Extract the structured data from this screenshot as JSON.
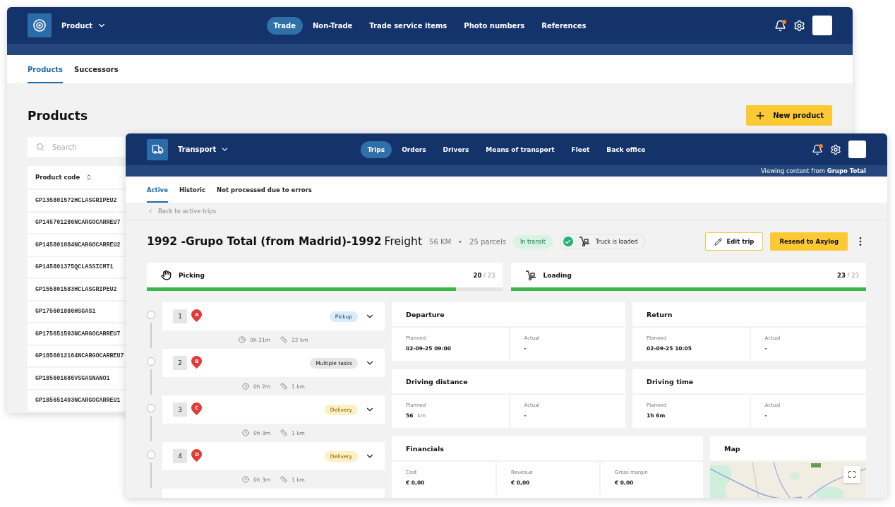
{
  "back_window": {
    "app": "Product",
    "nav": [
      {
        "label": "Trade",
        "selected": true
      },
      {
        "label": "Non-Trade",
        "selected": false
      },
      {
        "label": "Trade service items",
        "selected": false
      },
      {
        "label": "Photo numbers",
        "selected": false
      },
      {
        "label": "References",
        "selected": false
      }
    ],
    "tabs": [
      {
        "label": "Products",
        "selected": true
      },
      {
        "label": "Successors",
        "selected": false
      }
    ],
    "title": "Products",
    "new_button": "New product",
    "search": {
      "placeholder": "Search"
    },
    "table": {
      "columns": [
        "Product code"
      ],
      "rows": [
        "GP135801572HCLASGRIPEU2",
        "GP145701286NCARGOCARREU7",
        "GP145801084NCARGOCARREU2",
        "GP145801375QCLASSICMT1",
        "GP155801583HCLASGRIPEU2",
        "GP175601886HSGAS1",
        "GP175651593NCARGOCARREU7",
        "GP1856012104NCARGOCARREU7",
        "GP185601686VSGASNANO1",
        "GP185651493NCARGOCARREU1"
      ]
    }
  },
  "front_window": {
    "app": "Transport",
    "nav": [
      {
        "label": "Trips",
        "selected": true
      },
      {
        "label": "Orders",
        "selected": false
      },
      {
        "label": "Drivers",
        "selected": false
      },
      {
        "label": "Means of transport",
        "selected": false
      },
      {
        "label": "Fleet",
        "selected": false
      },
      {
        "label": "Back office",
        "selected": false
      }
    ],
    "viewing": "Viewing content from **Grupo Total**",
    "tabs": [
      {
        "label": "Active",
        "selected": true
      },
      {
        "label": "Historic",
        "selected": false
      },
      {
        "label": "Not processed due to errors",
        "selected": false
      }
    ],
    "back_link": "Back to active trips",
    "trip": {
      "title": "1992 -Grupo Total (from Madrid)-1992",
      "type": "Freight",
      "distance": "56 KM",
      "separator": "•",
      "parcels": "25 parcels",
      "status": "In transit",
      "loaded": "Truck is loaded"
    },
    "actions": [
      {
        "label": "Edit trip",
        "kind": "outline"
      },
      {
        "label": "Resend to Axylog",
        "kind": "primary"
      }
    ],
    "progress": [
      {
        "label": "Picking",
        "kind": "picking",
        "done": "20",
        "separator": "/",
        "total": "23",
        "level": 0.87
      },
      {
        "label": "Loading",
        "kind": "loading",
        "done": "23",
        "separator": "/",
        "total": "23",
        "level": 1
      }
    ],
    "stops": [
      {
        "number": "1",
        "marker": "A",
        "tag": "Pickup",
        "kind": "pickup",
        "time": "0h 21m",
        "distance": "22 km"
      },
      {
        "number": "2",
        "marker": "B",
        "tag": "Multiple tasks",
        "kind": "multiple",
        "time": "0h 2m",
        "distance": "1 km"
      },
      {
        "number": "3",
        "marker": "C",
        "tag": "Delivery",
        "kind": "delivery",
        "time": "0h 3m",
        "distance": "1 km"
      },
      {
        "number": "4",
        "marker": "D",
        "tag": "Delivery",
        "kind": "delivery",
        "time": "0h 3m",
        "distance": "1 km"
      }
    ],
    "cards": [
      {
        "title": "Departure",
        "fields": [
          {
            "label": "Planned",
            "value": "02-09-25 09:00"
          },
          {
            "label": "Actual",
            "value": "-"
          }
        ]
      },
      {
        "title": "Return",
        "fields": [
          {
            "label": "Planned",
            "value": "02-09-25 10:05"
          },
          {
            "label": "Actual",
            "value": "-"
          }
        ]
      },
      {
        "title": "Driving distance",
        "fields": [
          {
            "label": "Planned",
            "value": "56",
            "unit": "km"
          },
          {
            "label": "Actual",
            "value": "-"
          }
        ]
      },
      {
        "title": "Driving time",
        "fields": [
          {
            "label": "Planned",
            "value": "1h 6m"
          },
          {
            "label": "Actual",
            "value": "-"
          }
        ]
      }
    ],
    "financials": {
      "title": "Financials",
      "fields": [
        {
          "label": "Cost",
          "value": "€ 0,00"
        },
        {
          "label": "Revenue",
          "value": "€ 0,00"
        },
        {
          "label": "Gross margin",
          "value": "€ 0,00"
        }
      ]
    },
    "map": {
      "title": "Map"
    }
  }
}
